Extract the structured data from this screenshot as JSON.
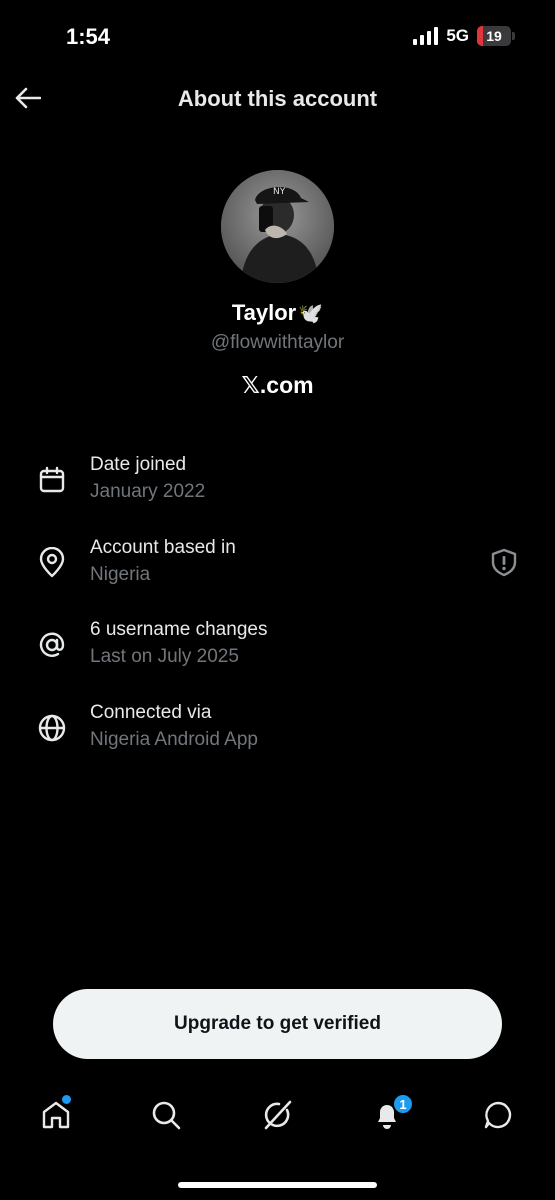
{
  "status_bar": {
    "time": "1:54",
    "network": "5G",
    "battery": "19",
    "battery_level": 0.19
  },
  "header": {
    "title": "About this account"
  },
  "profile": {
    "name": "Taylor",
    "name_emoji": "🕊️",
    "handle": "@flowwithtaylor",
    "site": "𝕏.com"
  },
  "info": [
    {
      "label": "Date joined",
      "value": "January 2022",
      "icon": "calendar-icon"
    },
    {
      "label": "Account based in",
      "value": "Nigeria",
      "icon": "location-pin-icon"
    },
    {
      "label": "6 username changes",
      "value": "Last on July 2025",
      "icon": "at-sign-icon"
    },
    {
      "label": "Connected via",
      "value": "Nigeria Android App",
      "icon": "globe-icon"
    }
  ],
  "upgrade_button": "Upgrade to get verified",
  "nav": {
    "notification_count": "1",
    "items": [
      "home-icon",
      "search-icon",
      "grok-icon",
      "notifications-icon",
      "messages-icon"
    ]
  },
  "colors": {
    "background": "#000000",
    "muted_text": "#71767b",
    "accent": "#1d9bf0",
    "battery_low": "#e0353b"
  }
}
